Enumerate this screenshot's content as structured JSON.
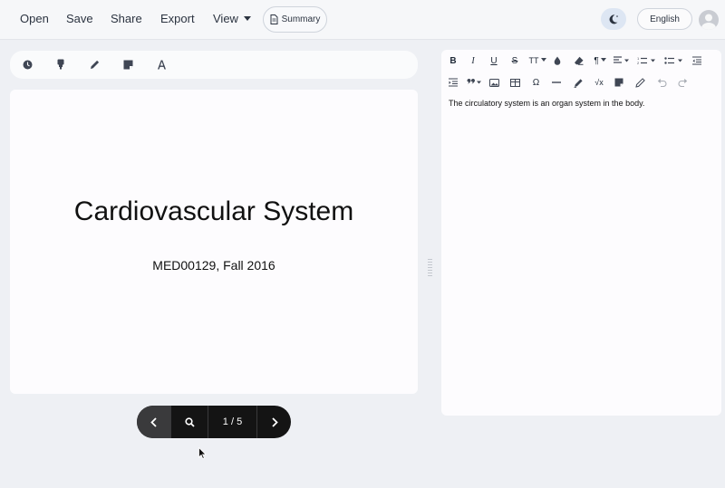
{
  "menu": {
    "open": "Open",
    "save": "Save",
    "share": "Share",
    "export": "Export",
    "view": "View",
    "summary": "Summary"
  },
  "header_right": {
    "language": "English"
  },
  "left_tools": [
    "clock-icon",
    "highlighter-icon",
    "pencil-icon",
    "sticky-note-icon",
    "text-icon"
  ],
  "slide": {
    "title": "Cardiovascular System",
    "subtitle": "MED00129, Fall 2016"
  },
  "pager": {
    "count": "1 / 5"
  },
  "editor": {
    "row1_tools": [
      "bold",
      "italic",
      "underline",
      "strikethrough",
      "text-size",
      "color",
      "eraser",
      "paragraph",
      "align",
      "ordered-list",
      "unordered-list",
      "outdent"
    ],
    "row2_tools": [
      "indent",
      "quote",
      "image",
      "table",
      "special-char",
      "horizontal-rule",
      "marker",
      "formula",
      "note",
      "pen",
      "undo",
      "redo"
    ],
    "bold_label": "B",
    "italic_label": "I",
    "underline_label": "U",
    "strike_label": "S",
    "textsize_label": "TT",
    "paragraph_label": "¶",
    "omega_label": "Ω",
    "formula_label": "√x",
    "content": "The circulatory system is an organ system in the body."
  },
  "colors": {
    "accent": "#dde6f3",
    "pager_bg": "#141414"
  }
}
